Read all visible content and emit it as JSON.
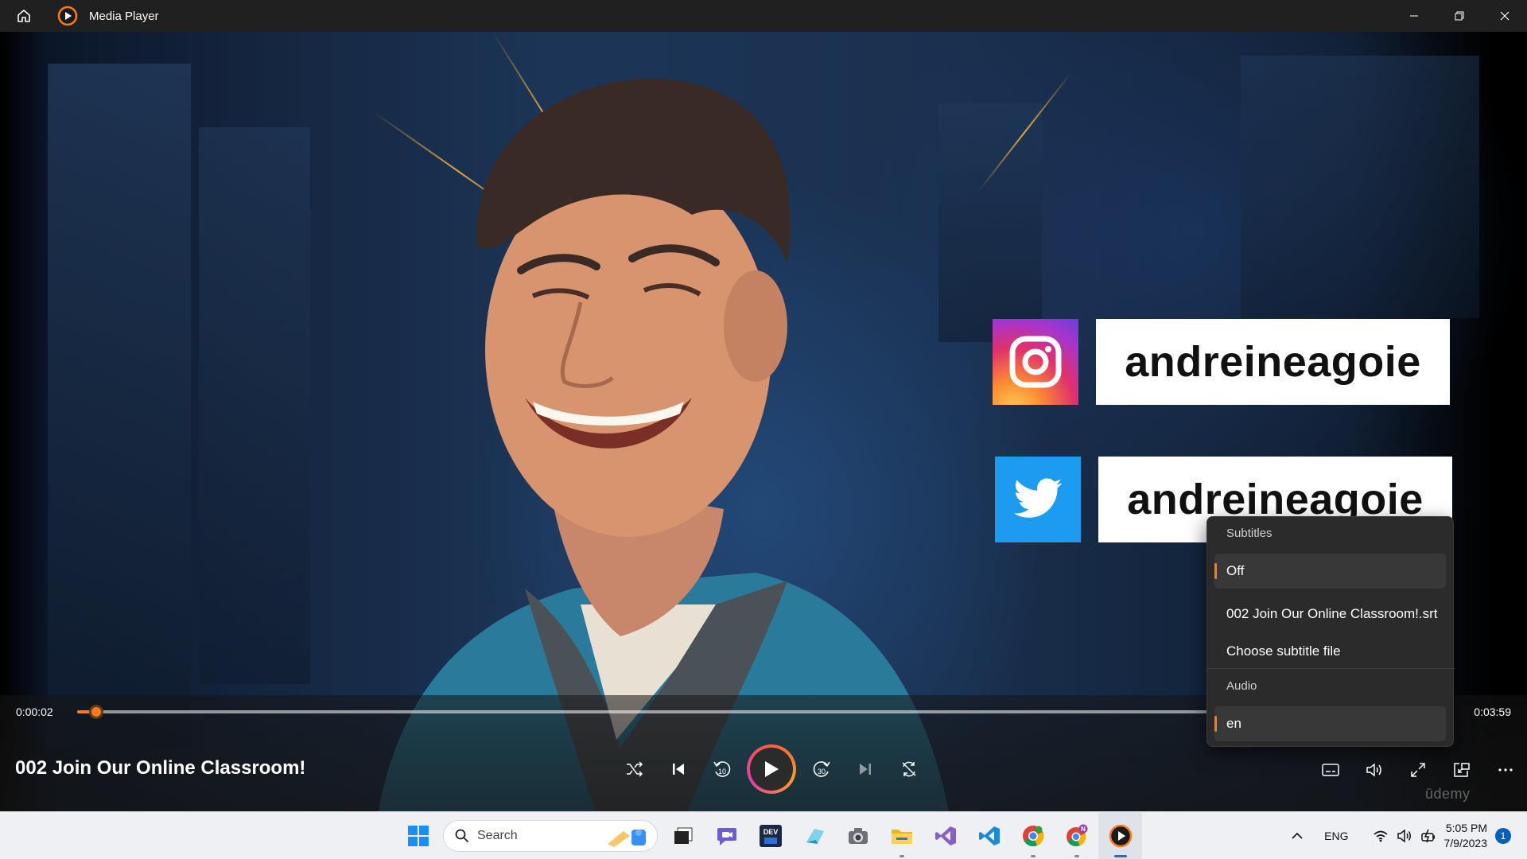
{
  "window": {
    "title": "Media Player",
    "icons": {
      "home": "home-icon",
      "app": "media-player-icon",
      "minimize": "minimize-icon",
      "restore": "restore-icon",
      "close": "close-icon"
    }
  },
  "video": {
    "socials": [
      {
        "network": "instagram",
        "icon": "instagram-icon",
        "handle": "andreineagoie"
      },
      {
        "network": "twitter",
        "icon": "twitter-icon",
        "handle": "andreineagoie"
      }
    ],
    "watermark": "ūdemy"
  },
  "player": {
    "current_time": "0:00:02",
    "duration": "0:03:59",
    "progress_percent": 1.4,
    "title": "002 Join Our Online Classroom!",
    "accent_color": "#ff7a1a",
    "controls": [
      "shuffle-icon",
      "previous-icon",
      "skip-back-10-icon",
      "play-icon",
      "skip-forward-30-icon",
      "next-icon",
      "repeat-icon"
    ],
    "right_controls": [
      "subtitles-icon",
      "volume-icon",
      "fullscreen-icon",
      "mini-view-icon",
      "more-icon"
    ],
    "skip_back_label": "10",
    "skip_forward_label": "30"
  },
  "flyout": {
    "subtitles_heading": "Subtitles",
    "subtitle_options": [
      {
        "label": "Off",
        "selected": true
      },
      {
        "label": "002 Join Our Online Classroom!.srt",
        "selected": false
      },
      {
        "label": "Choose subtitle file",
        "selected": false
      }
    ],
    "audio_heading": "Audio",
    "audio_options": [
      {
        "label": "en",
        "selected": true
      }
    ]
  },
  "taskbar": {
    "search_placeholder": "Search",
    "apps": [
      "windows-start-icon",
      "search-icon",
      "task-view-icon",
      "teams-chat-icon",
      "devhome-icon",
      "snipping-tool-icon",
      "camera-icon",
      "file-explorer-icon",
      "visual-studio-icon",
      "vscode-icon",
      "chrome-icon",
      "chrome-profile-icon",
      "media-player-icon"
    ],
    "language": "ENG",
    "time": "5:05 PM",
    "date": "7/9/2023",
    "notification_count": "1"
  }
}
